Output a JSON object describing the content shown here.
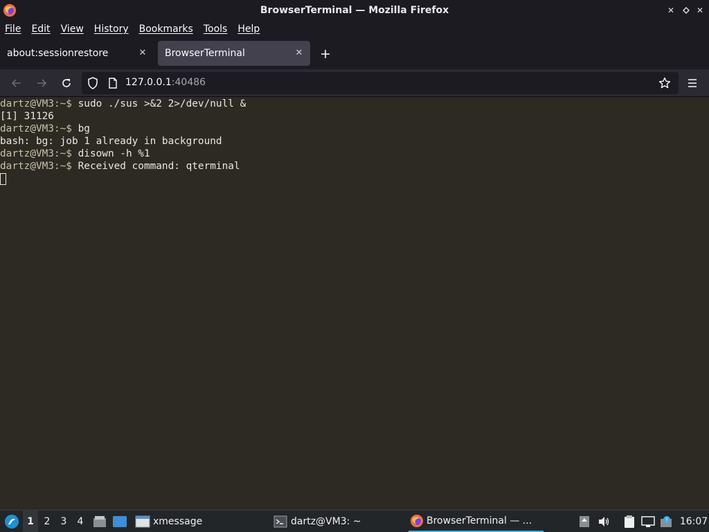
{
  "window": {
    "title": "BrowserTerminal — Mozilla Firefox",
    "controls": [
      "minimize-icon",
      "restore-icon",
      "close-icon"
    ]
  },
  "menubar": {
    "items": [
      "File",
      "Edit",
      "View",
      "History",
      "Bookmarks",
      "Tools",
      "Help"
    ]
  },
  "tabs": [
    {
      "label": "about:sessionrestore",
      "active": false
    },
    {
      "label": "BrowserTerminal",
      "active": true
    }
  ],
  "navbar": {
    "url_host": "127.0.0.1",
    "url_port": ":40486"
  },
  "terminal": {
    "prompt": "dartz@VM3:~$ ",
    "lines": [
      {
        "prompt": "dartz@VM3:~$ ",
        "text": "sudo ./sus >&2 2>/dev/null &"
      },
      {
        "prompt": "",
        "text": "[1] 31126"
      },
      {
        "prompt": "dartz@VM3:~$ ",
        "text": "bg"
      },
      {
        "prompt": "",
        "text": "bash: bg: job 1 already in background"
      },
      {
        "prompt": "dartz@VM3:~$ ",
        "text": "disown -h %1"
      },
      {
        "prompt": "dartz@VM3:~$ ",
        "text": "Received command: qterminal"
      }
    ]
  },
  "taskbar": {
    "workspaces": [
      "1",
      "2",
      "3",
      "4"
    ],
    "current_workspace": "1",
    "tasks": [
      {
        "label": "xmessage",
        "icon": "window-icon"
      },
      {
        "label": "dartz@VM3: ~",
        "icon": "terminal-icon"
      },
      {
        "label": "BrowserTerminal — ...",
        "icon": "firefox-icon",
        "active": true
      }
    ],
    "clock": "16:07"
  },
  "colors": {
    "accent": "#3daee9",
    "terminal_bg": "#2d2a24",
    "chrome_bg": "#1c1b22"
  }
}
